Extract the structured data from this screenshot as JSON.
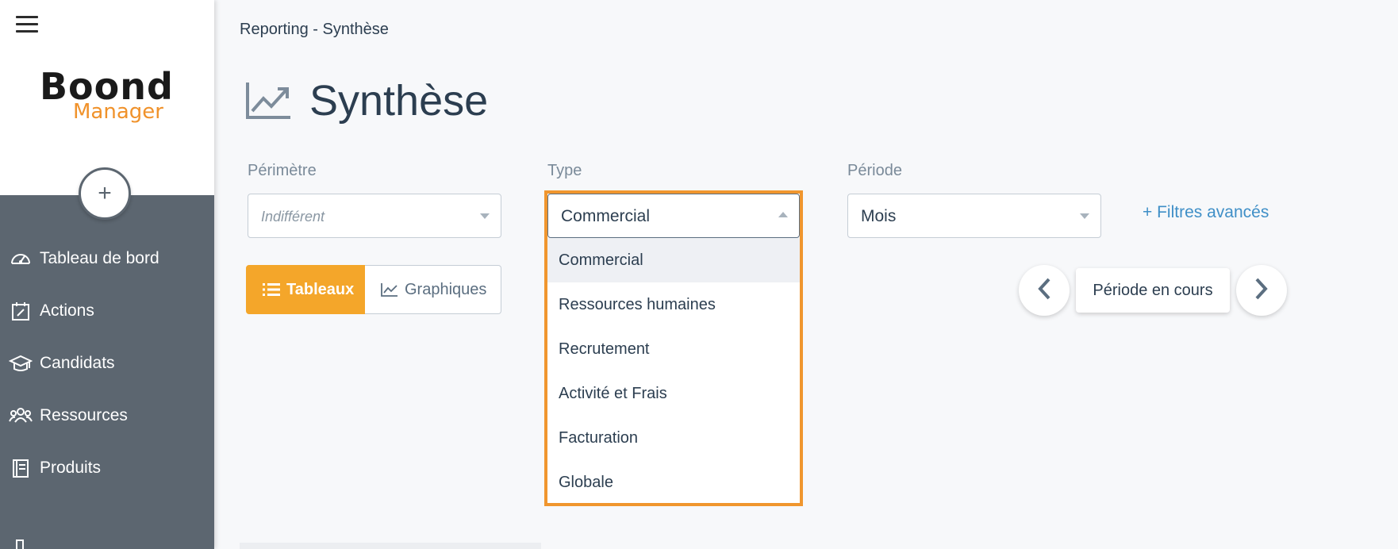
{
  "sidebar": {
    "logo": {
      "primary": "Boond",
      "secondary": "Manager"
    },
    "add_button": "+",
    "items": [
      {
        "label": "Tableau de bord",
        "icon": "dashboard-gauge-icon"
      },
      {
        "label": "Actions",
        "icon": "calendar-edit-icon"
      },
      {
        "label": "Candidats",
        "icon": "graduation-cap-icon"
      },
      {
        "label": "Ressources",
        "icon": "users-group-icon"
      },
      {
        "label": "Produits",
        "icon": "book-icon"
      }
    ]
  },
  "header": {
    "breadcrumb": "Reporting - Synthèse",
    "title": "Synthèse",
    "title_icon": "trending-chart-icon"
  },
  "filters": {
    "perimetre": {
      "label": "Périmètre",
      "placeholder": "Indifférent"
    },
    "type": {
      "label": "Type",
      "value": "Commercial",
      "options": [
        "Commercial",
        "Ressources humaines",
        "Recrutement",
        "Activité et Frais",
        "Facturation",
        "Globale"
      ],
      "selected_index": 0
    },
    "periode": {
      "label": "Période",
      "value": "Mois"
    },
    "advanced": "+ Filtres avancés"
  },
  "view_toggle": {
    "tables": "Tableaux",
    "charts": "Graphiques",
    "active": "tables"
  },
  "period_nav": {
    "current": "Période en cours"
  },
  "colors": {
    "accent": "#f4a62a",
    "highlight_frame": "#f0962e",
    "sidebar_bg": "#5c6670",
    "link": "#3f8fc7"
  }
}
